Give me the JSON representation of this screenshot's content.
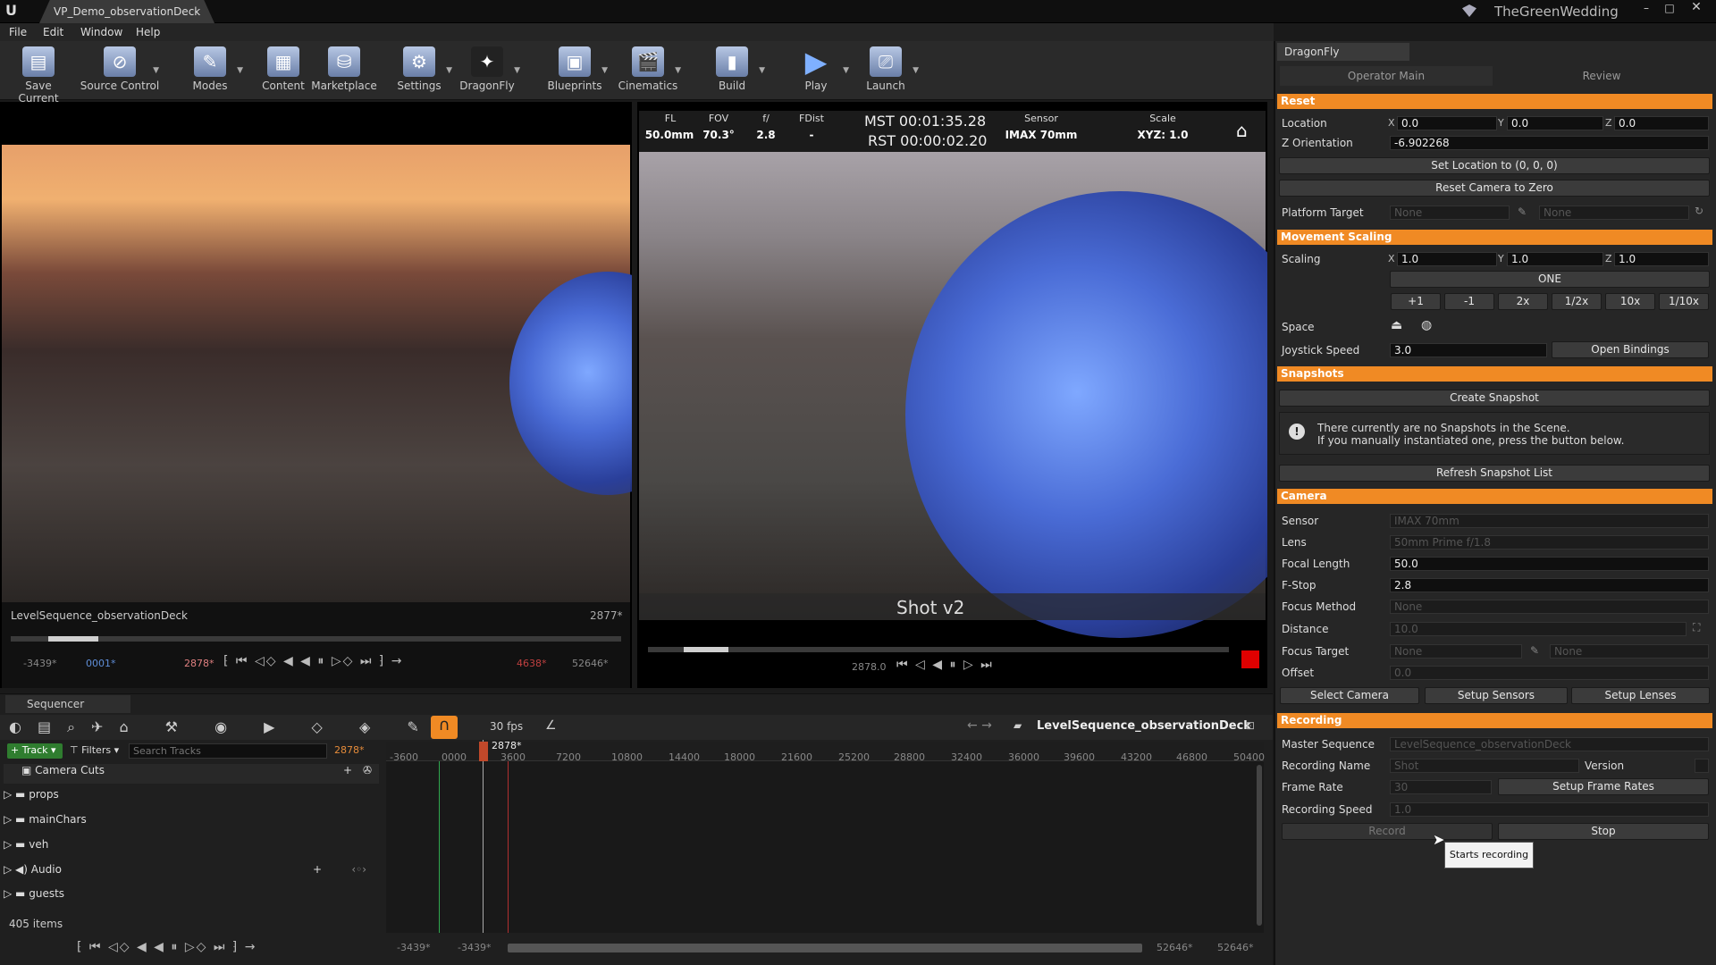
{
  "window": {
    "tab_title": "VP_Demo_observationDeck",
    "project": "TheGreenWedding"
  },
  "menu": [
    "File",
    "Edit",
    "Window",
    "Help"
  ],
  "toolbar": [
    {
      "label": "Save Current",
      "icon": "save-icon"
    },
    {
      "label": "Source Control",
      "icon": "source-control-icon"
    },
    {
      "label": "Modes",
      "icon": "modes-icon"
    },
    {
      "label": "Content",
      "icon": "content-icon"
    },
    {
      "label": "Marketplace",
      "icon": "marketplace-icon"
    },
    {
      "label": "Settings",
      "icon": "settings-icon"
    },
    {
      "label": "DragonFly",
      "icon": "dragonfly-icon"
    },
    {
      "label": "Blueprints",
      "icon": "blueprints-icon"
    },
    {
      "label": "Cinematics",
      "icon": "cinematics-icon"
    },
    {
      "label": "Build",
      "icon": "build-icon"
    },
    {
      "label": "Play",
      "icon": "play-icon"
    },
    {
      "label": "Launch",
      "icon": "launch-icon"
    }
  ],
  "viewport_left": {
    "sequence": "LevelSequence_observationDeck",
    "frame": "2877*",
    "t1": "-3439*",
    "t2": "0001*",
    "t3": "2878*",
    "t4": "4638*",
    "t5": "52646*"
  },
  "viewport_right": {
    "hud": [
      {
        "label": "FL",
        "value": "50.0mm"
      },
      {
        "label": "FOV",
        "value": "70.3°"
      },
      {
        "label": "f/",
        "value": "2.8"
      },
      {
        "label": "FDist",
        "value": "-"
      }
    ],
    "mst": "MST 00:01:35.28",
    "rst": "RST 00:00:02.20",
    "sensor_label": "Sensor",
    "sensor": "IMAX 70mm",
    "scale_label": "Scale",
    "scale": "XYZ: 1.0",
    "shot": "Shot v2",
    "frame": "2878.0"
  },
  "panel": {
    "tab": "DragonFly",
    "subtab_main": "Operator Main",
    "subtab_review": "Review",
    "reset": {
      "title": "Reset",
      "location_label": "Location",
      "x": "0.0",
      "y": "0.0",
      "z": "0.0",
      "zori_label": "Z Orientation",
      "zori": "-6.902268",
      "set_location": "Set Location to (0, 0, 0)",
      "reset_camera": "Reset Camera to Zero",
      "platform_label": "Platform Target",
      "platform": "None",
      "platform2": "None"
    },
    "movement": {
      "title": "Movement Scaling",
      "scaling_label": "Scaling",
      "x": "1.0",
      "y": "1.0",
      "z": "1.0",
      "one": "ONE",
      "steps": [
        "+1",
        "-1",
        "2x",
        "1/2x",
        "10x",
        "1/10x"
      ],
      "space_label": "Space",
      "joystick_label": "Joystick Speed",
      "joystick": "3.0",
      "open_bindings": "Open Bindings"
    },
    "snapshots": {
      "title": "Snapshots",
      "create": "Create Snapshot",
      "msg1": "There currently are no Snapshots in the Scene.",
      "msg2": "If you manually instantiated one, press the button below.",
      "refresh": "Refresh Snapshot List"
    },
    "camera": {
      "title": "Camera",
      "sensor_label": "Sensor",
      "sensor": "IMAX 70mm",
      "lens_label": "Lens",
      "lens": "50mm Prime f/1.8",
      "fl_label": "Focal Length",
      "fl": "50.0",
      "fstop_label": "F-Stop",
      "fstop": "2.8",
      "fm_label": "Focus Method",
      "fm": "None",
      "dist_label": "Distance",
      "dist": "10.0",
      "ft_label": "Focus Target",
      "ft": "None",
      "ft2": "None",
      "offset_label": "Offset",
      "offset": "0.0",
      "select": "Select Camera",
      "sensors": "Setup Sensors",
      "lenses": "Setup Lenses"
    },
    "recording": {
      "title": "Recording",
      "master_label": "Master Sequence",
      "master": "LevelSequence_observationDeck",
      "name_label": "Recording Name",
      "name": "Shot",
      "version_label": "Version",
      "fr_label": "Frame Rate",
      "fr": "30",
      "setup_fr": "Setup Frame Rates",
      "speed_label": "Recording Speed",
      "speed": "1.0",
      "record": "Record",
      "stop": "Stop",
      "tooltip": "Starts recording"
    }
  },
  "sequencer": {
    "tab": "Sequencer",
    "fps": "30 fps",
    "sequence": "LevelSequence_observationDeck",
    "track_btn": "Track",
    "filters": "Filters",
    "search_placeholder": "Search Tracks",
    "frame": "2878*",
    "playhead": "2878*",
    "tracks": [
      "Camera Cuts",
      "props",
      "mainChars",
      "veh",
      "Audio",
      "guests"
    ],
    "items": "405 items",
    "ruler": [
      "-3600",
      "0000",
      "3600",
      "7200",
      "10800",
      "14400",
      "18000",
      "21600",
      "25200",
      "28800",
      "32400",
      "36000",
      "39600",
      "43200",
      "46800",
      "50400"
    ],
    "bottom": {
      "a": "-3439*",
      "b": "-3439*",
      "c": "52646*",
      "d": "52646*"
    }
  }
}
